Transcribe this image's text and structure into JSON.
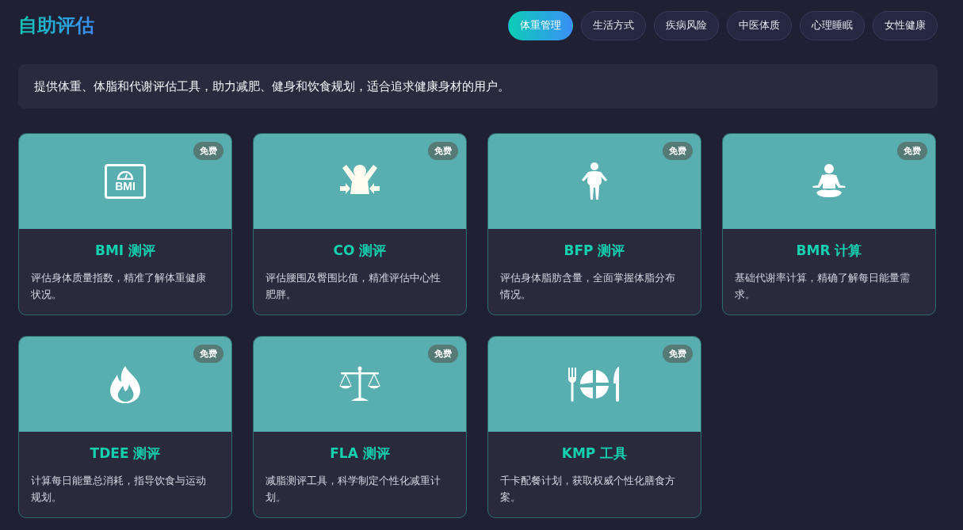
{
  "title": "自助评估",
  "tabs": [
    {
      "label": "体重管理",
      "selected": true
    },
    {
      "label": "生活方式",
      "selected": false
    },
    {
      "label": "疾病风险",
      "selected": false
    },
    {
      "label": "中医体质",
      "selected": false
    },
    {
      "label": "心理睡眠",
      "selected": false
    },
    {
      "label": "女性健康",
      "selected": false
    }
  ],
  "description": "提供体重、体脂和代谢评估工具，助力减肥、健身和饮食规划，适合追求健康身材的用户。",
  "cards": [
    {
      "kind": "scale",
      "icon_label": "BMI",
      "badge": "免费",
      "title": "BMI 测评",
      "text": "评估身体质量指数，精准了解体重健康状况。"
    },
    {
      "kind": "waist",
      "badge": "免费",
      "title": "CO 测评",
      "text": "评估腰围及臀围比值，精准评估中心性肥胖。"
    },
    {
      "kind": "body",
      "badge": "免费",
      "title": "BFP 测评",
      "text": "评估身体脂肪含量，全面掌握体脂分布情况。"
    },
    {
      "kind": "meditation",
      "badge": "免费",
      "title": "BMR 计算",
      "text": "基础代谢率计算，精确了解每日能量需求。"
    },
    {
      "kind": "flame",
      "badge": "免费",
      "title": "TDEE 测评",
      "text": "计算每日能量总消耗，指导饮食与运动规划。"
    },
    {
      "kind": "balance",
      "badge": "免费",
      "title": "FLA 测评",
      "text": "减脂测评工具，科学制定个性化减重计划。"
    },
    {
      "kind": "meal",
      "badge": "免费",
      "title": "KMP 工具",
      "text": "千卡配餐计划，获取权威个性化膳食方案。"
    }
  ]
}
